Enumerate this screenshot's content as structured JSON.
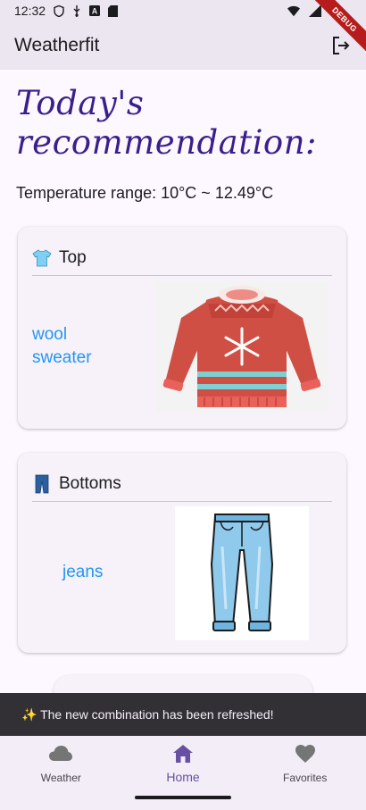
{
  "status_bar": {
    "time": "12:32",
    "icons": [
      "shield-icon",
      "usb-icon",
      "a-icon",
      "sd-card-icon"
    ],
    "right_icons": [
      "wifi-icon",
      "signal-icon"
    ]
  },
  "debug_banner": "DEBUG",
  "app_bar": {
    "title": "Weatherfit",
    "logout_icon": "logout-icon"
  },
  "main": {
    "heading": "Today's recommendation:",
    "temperature_text": "Temperature range: 10°C ~ 12.49°C",
    "cards": [
      {
        "icon": "shirt-icon",
        "label": "Top",
        "item": "wool sweater",
        "image": "sweater-image"
      },
      {
        "icon": "jeans-icon",
        "label": "Bottoms",
        "item": "jeans",
        "image": "jeans-image"
      }
    ]
  },
  "snackbar": {
    "message": "✨ The new combination has been refreshed!"
  },
  "nav": {
    "items": [
      {
        "label": "Weather",
        "icon": "cloud-icon",
        "active": false
      },
      {
        "label": "Home",
        "icon": "home-icon",
        "active": true
      },
      {
        "label": "Favorites",
        "icon": "heart-icon",
        "active": false
      }
    ]
  },
  "colors": {
    "heading": "#3a1f8c",
    "item_link": "#2196f3",
    "active_nav": "#6750a4",
    "app_bar_bg": "#ece6f0",
    "snackbar_bg": "#322f35"
  }
}
